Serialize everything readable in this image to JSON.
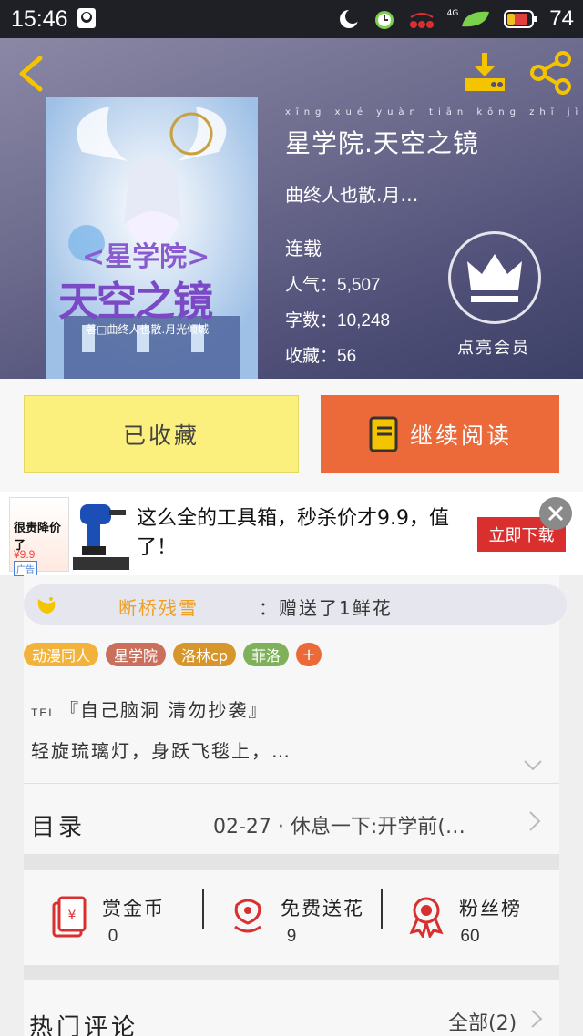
{
  "status_bar": {
    "time": "15:46",
    "network": "4G",
    "battery": "74"
  },
  "header": {
    "back_label": "",
    "download_label": "",
    "share_label": ""
  },
  "book": {
    "title": "星学院.天空之镜",
    "title_pinyin": "xīng xué yuàn tiān kōng zhī jìng",
    "author": "曲终人也散.月…",
    "status": "连载",
    "popularity_label": "人气：",
    "popularity": "5,507",
    "words_label": "字数：",
    "words": "10,248",
    "favorites_label": "收藏：",
    "favorites": "56",
    "cover_title": "<星学院>",
    "cover_subtitle": "天空之镜",
    "cover_author": "著□曲终人也散.月光倾城"
  },
  "vip": {
    "label": "点亮会员"
  },
  "actions": {
    "collected": "已收藏",
    "continue_read": "继续阅读"
  },
  "ad": {
    "thumb_title": "很贵降价了",
    "thumb_price": "¥9.9",
    "thumb_badge": "广告",
    "text": "这么全的工具箱，秒杀价才9.9，值了！",
    "cta": "立即下载"
  },
  "gift": {
    "user": "断桥残雪",
    "action": "：赠送了1鲜花"
  },
  "tags": [
    {
      "label": "动漫同人",
      "color": "#f3b23a"
    },
    {
      "label": "星学院",
      "color": "#c96f5c"
    },
    {
      "label": "洛林cp",
      "color": "#d6962c"
    },
    {
      "label": "菲洛",
      "color": "#7fb05a"
    }
  ],
  "tag_add": "+",
  "intro": {
    "prefix": "TEL",
    "line1": "『自己脑洞 清勿抄袭』",
    "line2": "轻旋琉璃灯，身跃飞毯上，…"
  },
  "toc": {
    "label": "目录",
    "latest": "02-27 · 休息一下:开学前(…"
  },
  "stats": [
    {
      "name": "赏金币",
      "value": "0"
    },
    {
      "name": "免费送花",
      "value": "9"
    },
    {
      "name": "粉丝榜",
      "value": "60"
    }
  ],
  "comments": {
    "label": "热门评论",
    "all": "全部(2)"
  },
  "colors": {
    "accent": "#ec6a3a",
    "collected_bg": "#fbf07d",
    "icon_red": "#d9302f",
    "icon_gold": "#e0a830"
  }
}
